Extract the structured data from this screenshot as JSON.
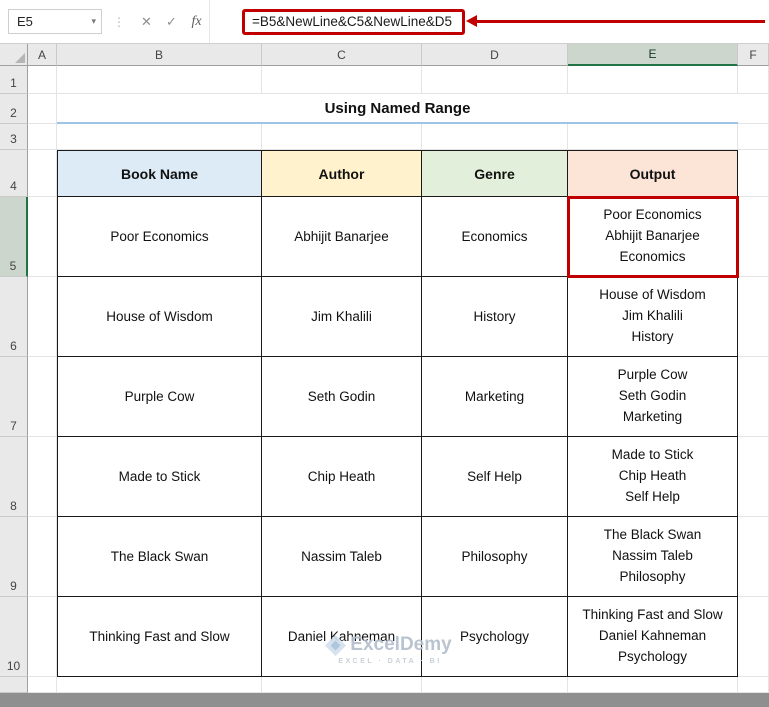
{
  "formula_bar": {
    "name_box": "E5",
    "formula": "=B5&NewLine&C5&NewLine&D5",
    "icons": {
      "dropdown": "▾",
      "resize_dots": "⋮",
      "cancel": "✕",
      "enter": "✓",
      "fx": "fx"
    }
  },
  "grid": {
    "column_headers": [
      "A",
      "B",
      "C",
      "D",
      "E",
      "F"
    ],
    "row_headers": [
      "1",
      "2",
      "3",
      "4",
      "5",
      "6",
      "7",
      "8",
      "9",
      "10"
    ],
    "selected_cell": "E5",
    "selected_column": "E",
    "selected_row": "5"
  },
  "sheet": {
    "title": "Using Named Range",
    "table": {
      "headers": [
        "Book Name",
        "Author",
        "Genre",
        "Output"
      ],
      "header_colors": {
        "book": "#DDEBF7",
        "author": "#FFF2CC",
        "genre": "#E2EFDA",
        "output": "#FCE4D6"
      },
      "rows": [
        {
          "book": "Poor Economics",
          "author": "Abhijit Banarjee",
          "genre": "Economics",
          "output": "Poor Economics\nAbhijit Banarjee\nEconomics"
        },
        {
          "book": "House of Wisdom",
          "author": "Jim Khalili",
          "genre": "History",
          "output": "House of Wisdom\nJim Khalili\nHistory"
        },
        {
          "book": "Purple Cow",
          "author": "Seth Godin",
          "genre": "Marketing",
          "output": "Purple Cow\nSeth Godin\nMarketing"
        },
        {
          "book": "Made to Stick",
          "author": "Chip Heath",
          "genre": "Self Help",
          "output": "Made to Stick\nChip Heath\nSelf Help"
        },
        {
          "book": "The Black Swan",
          "author": "Nassim Taleb",
          "genre": "Philosophy",
          "output": "The Black Swan\nNassim Taleb\nPhilosophy"
        },
        {
          "book": "Thinking Fast and Slow",
          "author": "Daniel Kahneman",
          "genre": "Psychology",
          "output": "Thinking Fast and Slow\nDaniel Kahneman\nPsychology"
        }
      ]
    }
  },
  "watermark": {
    "brand": "ExcelDemy",
    "tagline": "EXCEL · DATA · BI"
  },
  "colors": {
    "annotation": "#C00000",
    "title_underline": "#9DC3E6",
    "selected_header_accent": "#217346"
  }
}
